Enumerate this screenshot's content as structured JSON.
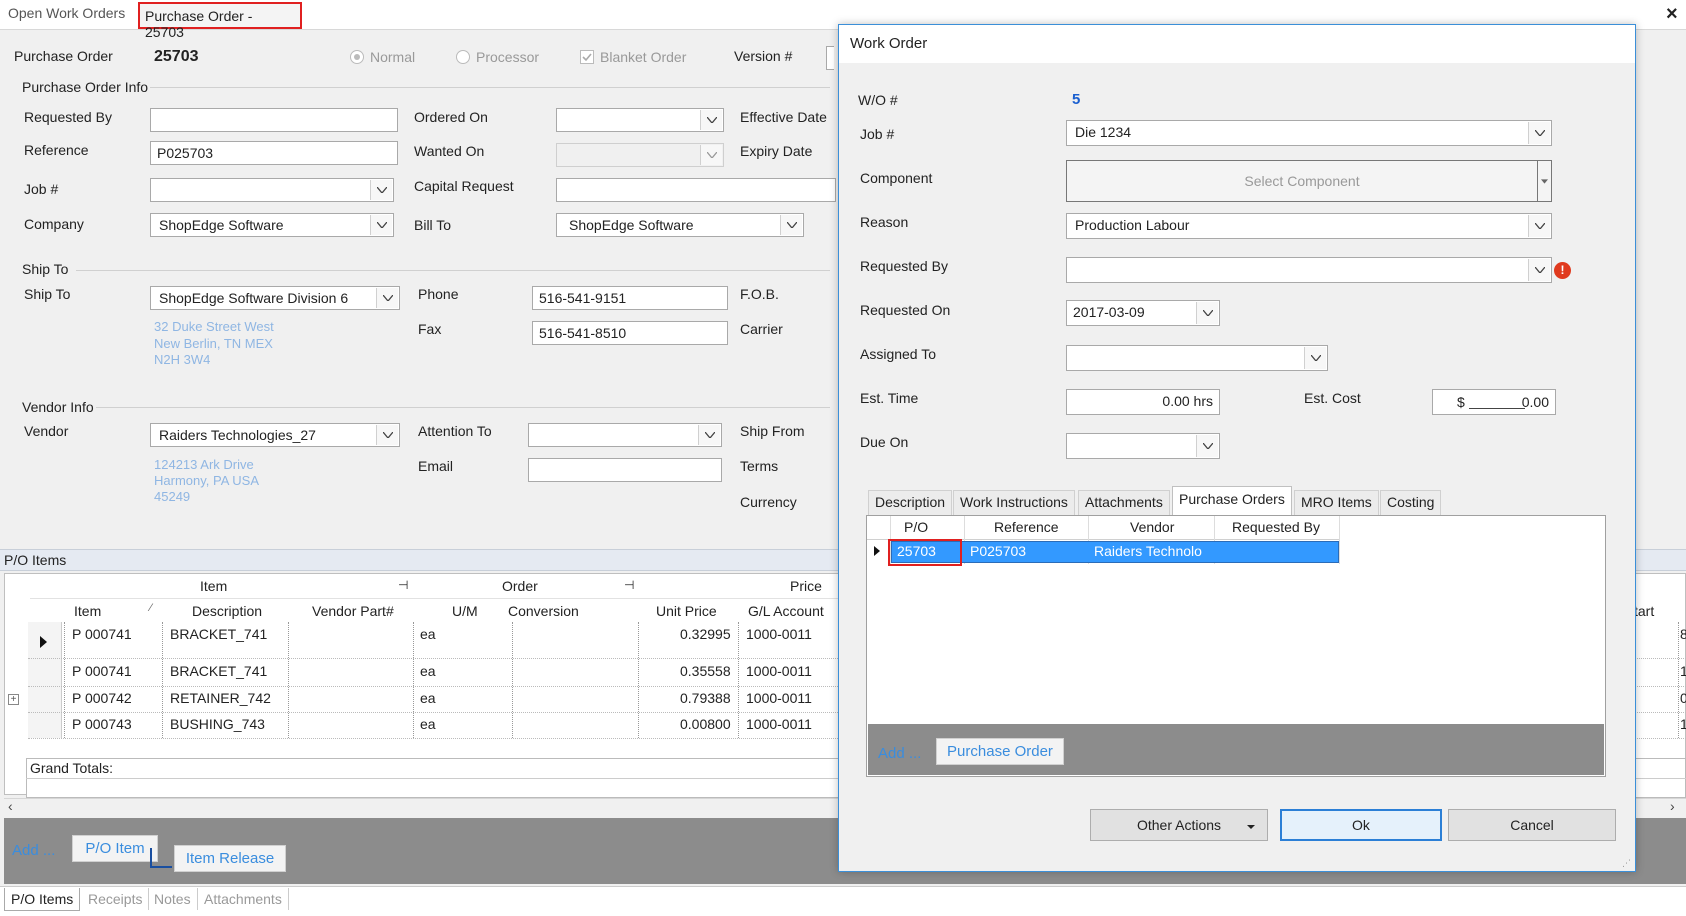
{
  "tabs": {
    "open_work_orders": "Open Work Orders",
    "purchase_order": "Purchase Order - 25703",
    "close": "×"
  },
  "po": {
    "label": "Purchase Order",
    "number": "25703",
    "radio_normal": "Normal",
    "radio_processor": "Processor",
    "blanket": "Blanket Order",
    "version_label": "Version #",
    "info_group": "Purchase Order Info",
    "requested_by_label": "Requested By",
    "requested_by_value": "",
    "reference_label": "Reference",
    "reference_value": "P025703",
    "job_label": "Job #",
    "job_value": "",
    "company_label": "Company",
    "company_value": "ShopEdge Software",
    "ordered_on_label": "Ordered On",
    "wanted_on_label": "Wanted On",
    "capital_request_label": "Capital Request",
    "bill_to_label": "Bill To",
    "bill_to_value": "ShopEdge Software",
    "effective_date_label": "Effective Date",
    "expiry_date_label": "Expiry Date",
    "ship_to_group": "Ship To",
    "ship_to_label": "Ship To",
    "ship_to_value": "ShopEdge Software Division 6",
    "ship_addr1": "32 Duke Street West",
    "ship_addr2": "New Berlin, TN MEX",
    "ship_addr3": "N2H 3W4",
    "phone_label": "Phone",
    "phone_value": "516-541-9151",
    "fax_label": "Fax",
    "fax_value": "516-541-8510",
    "fob_label": "F.O.B.",
    "carrier_label": "Carrier",
    "vendor_group": "Vendor Info",
    "vendor_label": "Vendor",
    "vendor_value": "Raiders Technologies_27",
    "vendor_addr1": "124213 Ark Drive",
    "vendor_addr2": "Harmony, PA USA",
    "vendor_addr3": "45249",
    "attention_label": "Attention To",
    "email_label": "Email",
    "ship_from_label": "Ship From",
    "terms_label": "Terms",
    "currency_label": "Currency"
  },
  "po_items": {
    "title": "P/O Items",
    "band_item": "Item",
    "band_order": "Order",
    "band_price": "Price",
    "columns": [
      "Item",
      "Description",
      "Vendor Part#",
      "U/M",
      "Conversion",
      "Unit Price",
      "G/L Account"
    ],
    "right_col_fragment": "tart",
    "rows": [
      [
        "P 000741",
        "BRACKET_741",
        "",
        "ea",
        "",
        "0.32995",
        "1000-0011"
      ],
      [
        "P 000741",
        "BRACKET_741",
        "",
        "ea",
        "",
        "0.35558",
        "1000-0011"
      ],
      [
        "P 000742",
        "RETAINER_742",
        "",
        "ea",
        "",
        "0.79388",
        "1000-0011"
      ],
      [
        "P 000743",
        "BUSHING_743",
        "",
        "ea",
        "",
        "0.00800",
        "1000-0011"
      ]
    ],
    "right_fragments": [
      "8",
      "1",
      "0",
      "1"
    ],
    "grand_totals": "Grand Totals:",
    "add": "Add ...",
    "po_item_btn": "P/O Item",
    "item_release_btn": "Item Release",
    "bottom_tabs": [
      "P/O Items",
      "Receipts",
      "Notes",
      "Attachments"
    ]
  },
  "dialog": {
    "title": "Work Order",
    "wo_label": "W/O #",
    "wo_value": "5",
    "job_label": "Job #",
    "job_value": "Die 1234",
    "component_label": "Component",
    "select_component": "Select Component",
    "reason_label": "Reason",
    "reason_value": "Production Labour",
    "requested_by_label": "Requested By",
    "requested_by_value": "",
    "requested_on_label": "Requested On",
    "requested_on_value": "2017-03-09",
    "assigned_to_label": "Assigned To",
    "assigned_to_value": "",
    "est_time_label": "Est. Time",
    "est_time_value": "0.00 hrs",
    "est_cost_label": "Est. Cost",
    "est_cost_currency": "$",
    "est_cost_value": "0.00",
    "due_on_label": "Due On",
    "due_on_value": "",
    "tabs": [
      "Description",
      "Work Instructions",
      "Attachments",
      "Purchase Orders",
      "MRO Items",
      "Costing"
    ],
    "active_tab": "Purchase Orders",
    "grid_columns": [
      "P/O",
      "Reference",
      "Vendor",
      "Requested By"
    ],
    "grid_row": [
      "25703",
      "P025703",
      "Raiders Technolo",
      ""
    ],
    "add": "Add ...",
    "purchase_order_btn": "Purchase Order",
    "other_actions": "Other Actions",
    "ok": "Ok",
    "cancel": "Cancel"
  },
  "colors": {
    "accent": "#3a8dde",
    "selection": "#3399ff",
    "highlight_box": "#e02020",
    "error": "#e03a1e",
    "wo_number": "#1a5fd0"
  }
}
